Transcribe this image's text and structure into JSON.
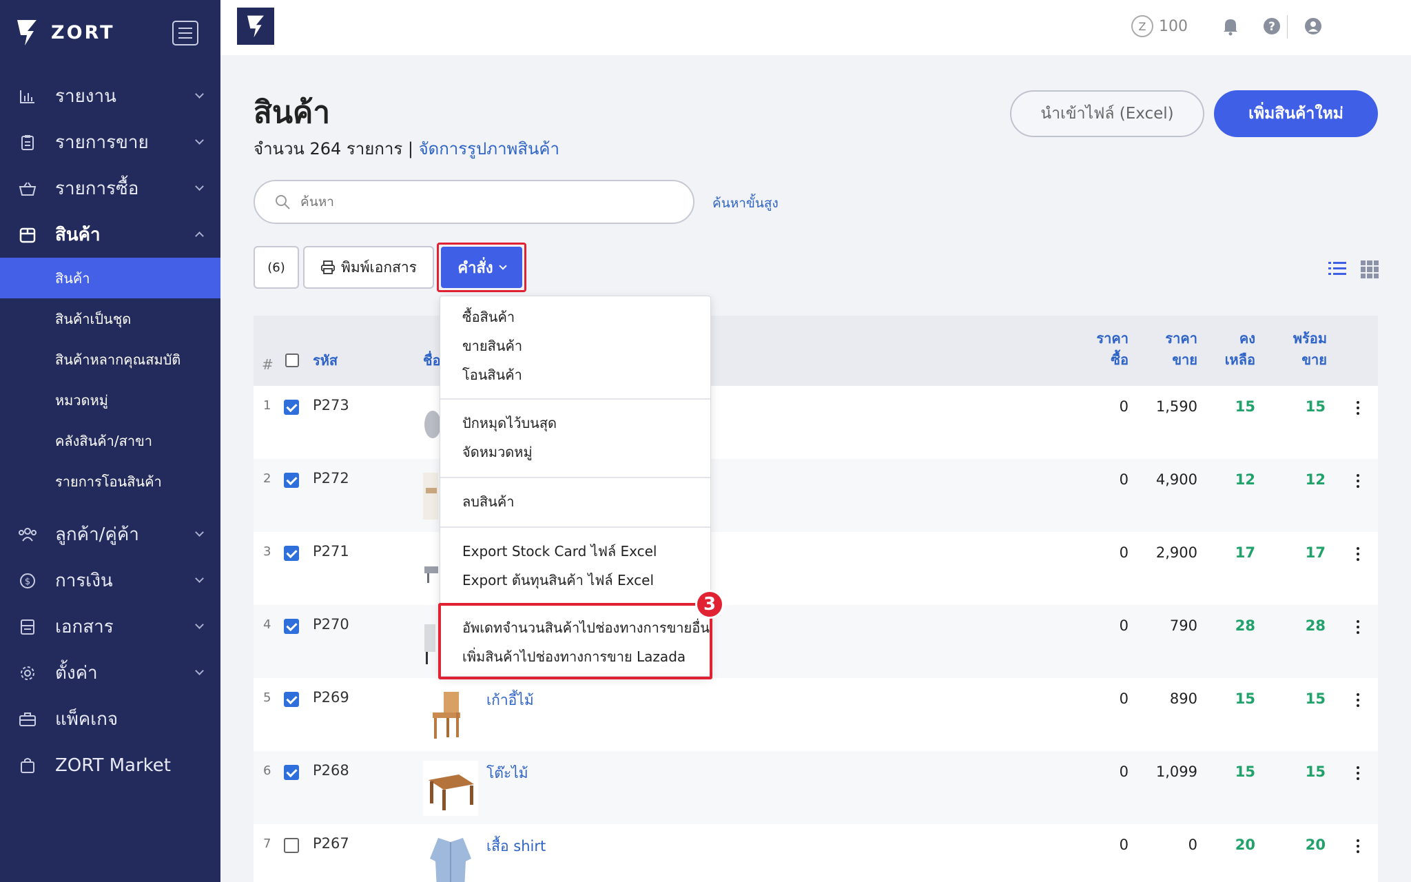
{
  "brand": {
    "name": "ZORT"
  },
  "sidebar": {
    "items": [
      {
        "label": "รายงาน",
        "icon": "chart-icon"
      },
      {
        "label": "รายการขาย",
        "icon": "clipboard-icon"
      },
      {
        "label": "รายการซื้อ",
        "icon": "basket-icon"
      },
      {
        "label": "สินค้า",
        "icon": "box-icon",
        "expanded": true
      },
      {
        "label": "ลูกค้า/คู่ค้า",
        "icon": "users-icon"
      },
      {
        "label": "การเงิน",
        "icon": "coin-icon"
      },
      {
        "label": "เอกสาร",
        "icon": "document-icon"
      },
      {
        "label": "ตั้งค่า",
        "icon": "gear-icon"
      },
      {
        "label": "แพ็คเกจ",
        "icon": "briefcase-icon"
      },
      {
        "label": "ZORT Market",
        "icon": "bag-icon"
      }
    ],
    "sub_items": [
      "สินค้า",
      "สินค้าเป็นชุด",
      "สินค้าหลากคุณสมบัติ",
      "หมวดหมู่",
      "คลังสินค้า/สาขา",
      "รายการโอนสินค้า"
    ]
  },
  "topbar": {
    "points": "100"
  },
  "header": {
    "title": "สินค้า",
    "subtitle_prefix": "จำนวน 264 รายการ | ",
    "subtitle_link": "จัดการรูปภาพสินค้า",
    "import_button": "นำเข้าไฟล์ (Excel)",
    "add_button": "เพิ่มสินค้าใหม่"
  },
  "search": {
    "placeholder": "ค้นหา",
    "advanced": "ค้นหาขั้นสูง"
  },
  "toolbar": {
    "count": "(6)",
    "print": "พิมพ์เอกสาร",
    "command": "คำสั่ง"
  },
  "table": {
    "headers": {
      "hash": "#",
      "code": "รหัส",
      "name": "ชื่อ",
      "buy_1": "ราคา",
      "buy_2": "ซื้อ",
      "sell_1": "ราคา",
      "sell_2": "ขาย",
      "rem_1": "คง",
      "rem_2": "เหลือ",
      "ready_1": "พร้อม",
      "ready_2": "ขาย"
    },
    "rows": [
      {
        "num": "1",
        "checked": true,
        "code": "P273",
        "name": "",
        "buy": "0",
        "sell": "1,590",
        "remaining": "15",
        "ready": "15"
      },
      {
        "num": "2",
        "checked": true,
        "code": "P272",
        "name": "",
        "buy": "0",
        "sell": "4,900",
        "remaining": "12",
        "ready": "12"
      },
      {
        "num": "3",
        "checked": true,
        "code": "P271",
        "name": "",
        "buy": "0",
        "sell": "2,900",
        "remaining": "17",
        "ready": "17"
      },
      {
        "num": "4",
        "checked": true,
        "code": "P270",
        "name": "",
        "buy": "0",
        "sell": "790",
        "remaining": "28",
        "ready": "28"
      },
      {
        "num": "5",
        "checked": true,
        "code": "P269",
        "name": "เก้าอี้ไม้",
        "buy": "0",
        "sell": "890",
        "remaining": "15",
        "ready": "15"
      },
      {
        "num": "6",
        "checked": true,
        "code": "P268",
        "name": "โต๊ะไม้",
        "buy": "0",
        "sell": "1,099",
        "remaining": "15",
        "ready": "15"
      },
      {
        "num": "7",
        "checked": false,
        "code": "P267",
        "name": "เสื้อ shirt",
        "buy": "0",
        "sell": "0",
        "remaining": "20",
        "ready": "20"
      }
    ]
  },
  "dropdown": {
    "groups": [
      [
        "ซื้อสินค้า",
        "ขายสินค้า",
        "โอนสินค้า"
      ],
      [
        "ปักหมุดไว้บนสุด",
        "จัดหมวดหมู่"
      ],
      [
        "ลบสินค้า"
      ],
      [
        "Export Stock Card ไฟล์ Excel",
        "Export ต้นทุนสินค้า ไฟล์ Excel"
      ],
      [
        "อัพเดทจำนวนสินค้าไปช่องทางการขายอื่น",
        "เพิ่มสินค้าไปช่องทางการขาย Lazada"
      ]
    ],
    "step_badge": "3"
  },
  "colors": {
    "sidebar": "#232a5c",
    "accent": "#3f5fe6",
    "link": "#2e63c7",
    "stock_green": "#22a26b",
    "highlight_red": "#e02232"
  }
}
